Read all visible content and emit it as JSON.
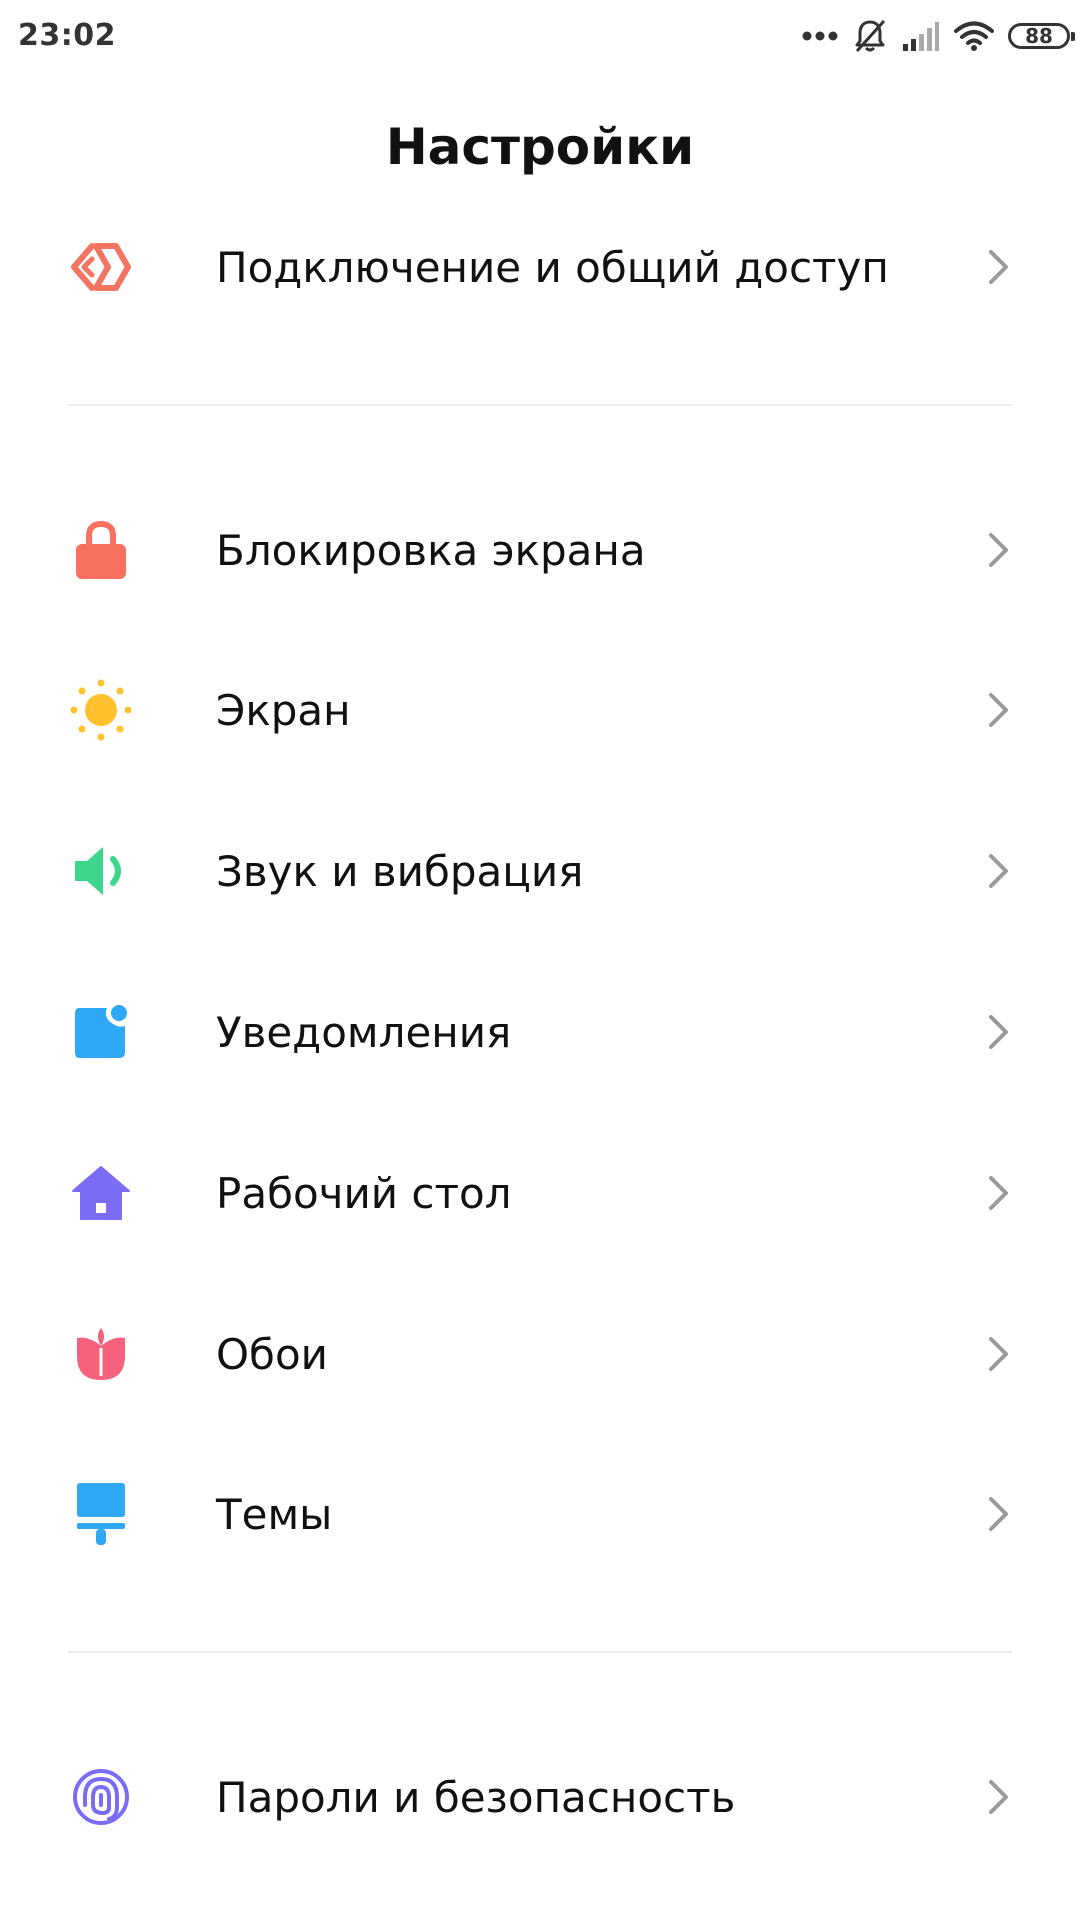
{
  "status_bar": {
    "time": "23:02",
    "battery": "88",
    "icons": [
      "more-dots-icon",
      "notifications-muted-icon",
      "signal-icon",
      "wifi-icon",
      "battery-icon"
    ]
  },
  "header": {
    "title": "Настройки"
  },
  "settings": [
    {
      "label": "Подключение и общий доступ",
      "icon": "connection-sharing-icon",
      "color": "#F27561"
    },
    {
      "label": "Блокировка экрана",
      "icon": "lock-icon",
      "color": "#F87060"
    },
    {
      "label": "Экран",
      "icon": "sun-icon",
      "color": "#FFC12E"
    },
    {
      "label": "Звук и вибрация",
      "icon": "speaker-icon",
      "color": "#3DD68C"
    },
    {
      "label": "Уведомления",
      "icon": "notification-icon",
      "color": "#2FA8F5"
    },
    {
      "label": "Рабочий стол",
      "icon": "home-icon",
      "color": "#7B6CF5"
    },
    {
      "label": "Обои",
      "icon": "tulip-icon",
      "color": "#F5607D"
    },
    {
      "label": "Темы",
      "icon": "brush-icon",
      "color": "#2FA8F5"
    },
    {
      "label": "Пароли и безопасность",
      "icon": "fingerprint-icon",
      "color": "#7B6CF5"
    }
  ]
}
